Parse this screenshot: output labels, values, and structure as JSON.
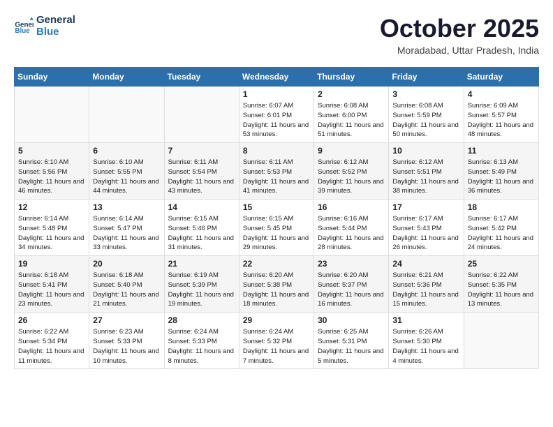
{
  "logo": {
    "line1": "General",
    "line2": "Blue"
  },
  "title": "October 2025",
  "subtitle": "Moradabad, Uttar Pradesh, India",
  "weekdays": [
    "Sunday",
    "Monday",
    "Tuesday",
    "Wednesday",
    "Thursday",
    "Friday",
    "Saturday"
  ],
  "weeks": [
    [
      {
        "day": "",
        "info": ""
      },
      {
        "day": "",
        "info": ""
      },
      {
        "day": "",
        "info": ""
      },
      {
        "day": "1",
        "info": "Sunrise: 6:07 AM\nSunset: 6:01 PM\nDaylight: 11 hours and 53 minutes."
      },
      {
        "day": "2",
        "info": "Sunrise: 6:08 AM\nSunset: 6:00 PM\nDaylight: 11 hours and 51 minutes."
      },
      {
        "day": "3",
        "info": "Sunrise: 6:08 AM\nSunset: 5:59 PM\nDaylight: 11 hours and 50 minutes."
      },
      {
        "day": "4",
        "info": "Sunrise: 6:09 AM\nSunset: 5:57 PM\nDaylight: 11 hours and 48 minutes."
      }
    ],
    [
      {
        "day": "5",
        "info": "Sunrise: 6:10 AM\nSunset: 5:56 PM\nDaylight: 11 hours and 46 minutes."
      },
      {
        "day": "6",
        "info": "Sunrise: 6:10 AM\nSunset: 5:55 PM\nDaylight: 11 hours and 44 minutes."
      },
      {
        "day": "7",
        "info": "Sunrise: 6:11 AM\nSunset: 5:54 PM\nDaylight: 11 hours and 43 minutes."
      },
      {
        "day": "8",
        "info": "Sunrise: 6:11 AM\nSunset: 5:53 PM\nDaylight: 11 hours and 41 minutes."
      },
      {
        "day": "9",
        "info": "Sunrise: 6:12 AM\nSunset: 5:52 PM\nDaylight: 11 hours and 39 minutes."
      },
      {
        "day": "10",
        "info": "Sunrise: 6:12 AM\nSunset: 5:51 PM\nDaylight: 11 hours and 38 minutes."
      },
      {
        "day": "11",
        "info": "Sunrise: 6:13 AM\nSunset: 5:49 PM\nDaylight: 11 hours and 36 minutes."
      }
    ],
    [
      {
        "day": "12",
        "info": "Sunrise: 6:14 AM\nSunset: 5:48 PM\nDaylight: 11 hours and 34 minutes."
      },
      {
        "day": "13",
        "info": "Sunrise: 6:14 AM\nSunset: 5:47 PM\nDaylight: 11 hours and 33 minutes."
      },
      {
        "day": "14",
        "info": "Sunrise: 6:15 AM\nSunset: 5:46 PM\nDaylight: 11 hours and 31 minutes."
      },
      {
        "day": "15",
        "info": "Sunrise: 6:15 AM\nSunset: 5:45 PM\nDaylight: 11 hours and 29 minutes."
      },
      {
        "day": "16",
        "info": "Sunrise: 6:16 AM\nSunset: 5:44 PM\nDaylight: 11 hours and 28 minutes."
      },
      {
        "day": "17",
        "info": "Sunrise: 6:17 AM\nSunset: 5:43 PM\nDaylight: 11 hours and 26 minutes."
      },
      {
        "day": "18",
        "info": "Sunrise: 6:17 AM\nSunset: 5:42 PM\nDaylight: 11 hours and 24 minutes."
      }
    ],
    [
      {
        "day": "19",
        "info": "Sunrise: 6:18 AM\nSunset: 5:41 PM\nDaylight: 11 hours and 23 minutes."
      },
      {
        "day": "20",
        "info": "Sunrise: 6:18 AM\nSunset: 5:40 PM\nDaylight: 11 hours and 21 minutes."
      },
      {
        "day": "21",
        "info": "Sunrise: 6:19 AM\nSunset: 5:39 PM\nDaylight: 11 hours and 19 minutes."
      },
      {
        "day": "22",
        "info": "Sunrise: 6:20 AM\nSunset: 5:38 PM\nDaylight: 11 hours and 18 minutes."
      },
      {
        "day": "23",
        "info": "Sunrise: 6:20 AM\nSunset: 5:37 PM\nDaylight: 11 hours and 16 minutes."
      },
      {
        "day": "24",
        "info": "Sunrise: 6:21 AM\nSunset: 5:36 PM\nDaylight: 11 hours and 15 minutes."
      },
      {
        "day": "25",
        "info": "Sunrise: 6:22 AM\nSunset: 5:35 PM\nDaylight: 11 hours and 13 minutes."
      }
    ],
    [
      {
        "day": "26",
        "info": "Sunrise: 6:22 AM\nSunset: 5:34 PM\nDaylight: 11 hours and 11 minutes."
      },
      {
        "day": "27",
        "info": "Sunrise: 6:23 AM\nSunset: 5:33 PM\nDaylight: 11 hours and 10 minutes."
      },
      {
        "day": "28",
        "info": "Sunrise: 6:24 AM\nSunset: 5:33 PM\nDaylight: 11 hours and 8 minutes."
      },
      {
        "day": "29",
        "info": "Sunrise: 6:24 AM\nSunset: 5:32 PM\nDaylight: 11 hours and 7 minutes."
      },
      {
        "day": "30",
        "info": "Sunrise: 6:25 AM\nSunset: 5:31 PM\nDaylight: 11 hours and 5 minutes."
      },
      {
        "day": "31",
        "info": "Sunrise: 6:26 AM\nSunset: 5:30 PM\nDaylight: 11 hours and 4 minutes."
      },
      {
        "day": "",
        "info": ""
      }
    ]
  ]
}
